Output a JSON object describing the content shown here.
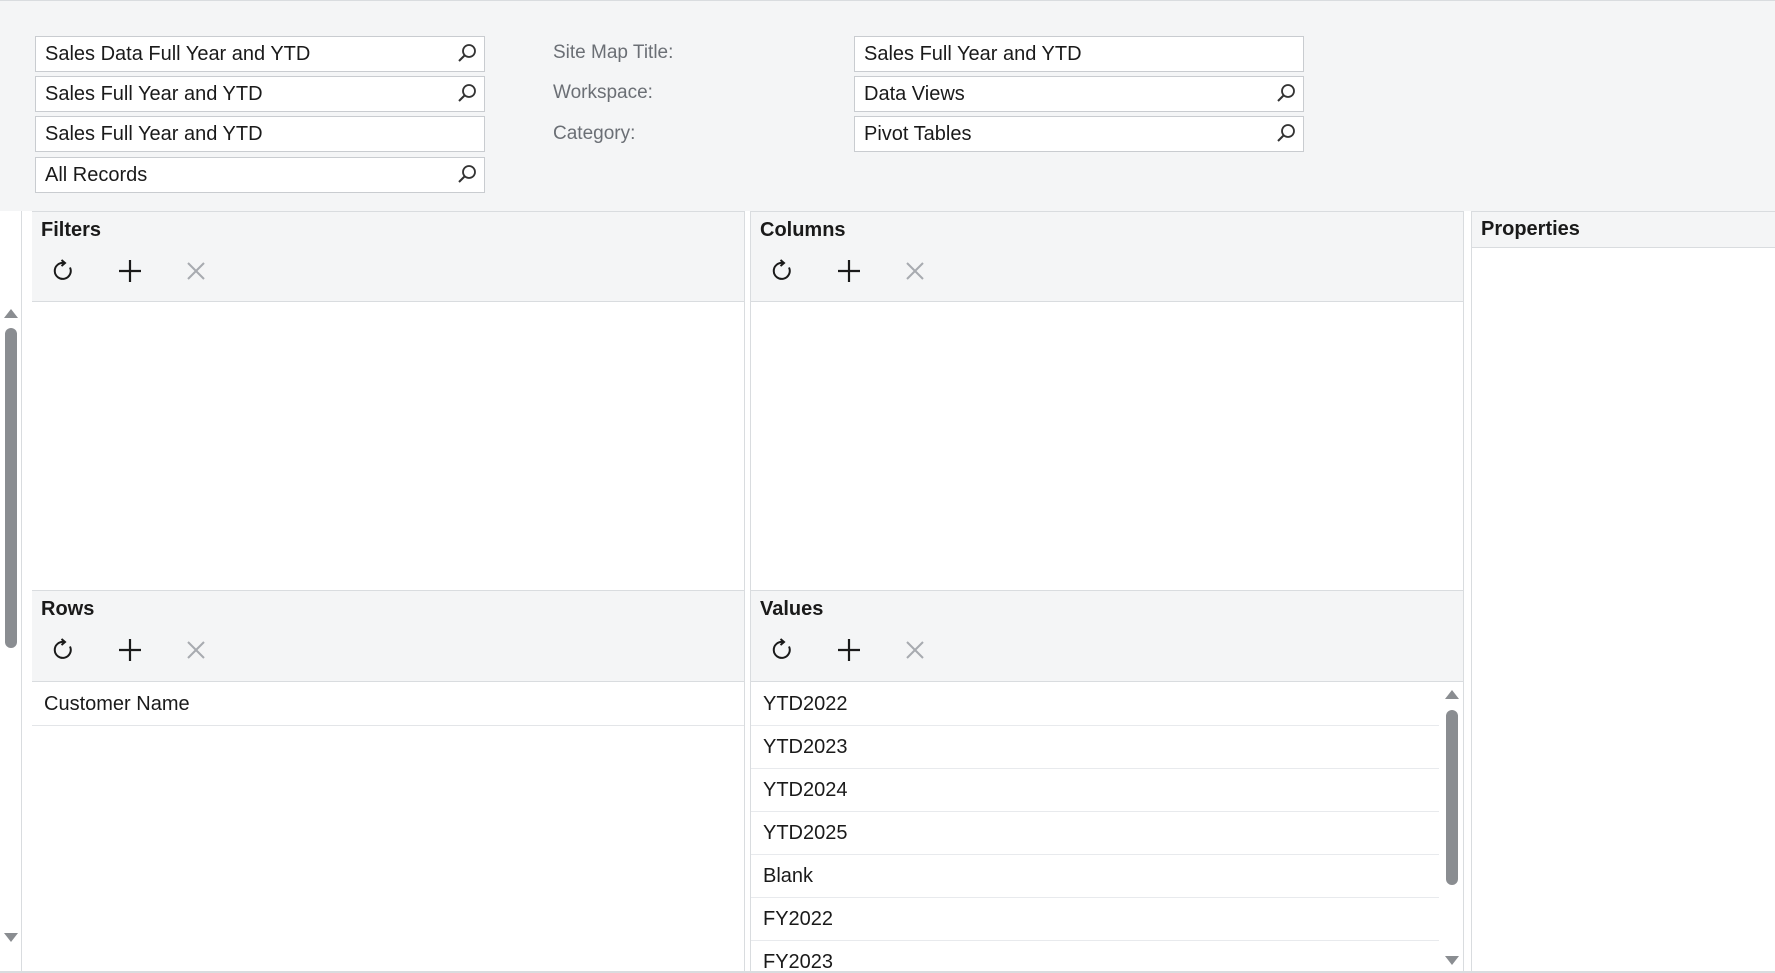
{
  "form": {
    "fields_left": [
      {
        "value": "Sales Data  Full Year and YTD",
        "has_lookup": true
      },
      {
        "value": "Sales Full Year and YTD",
        "has_lookup": true
      },
      {
        "value": "Sales Full Year and YTD",
        "has_lookup": false
      },
      {
        "value": "All Records",
        "has_lookup": true
      }
    ],
    "site_map_title_label": "Site Map Title:",
    "site_map_title_value": "Sales Full Year and YTD",
    "workspace_label": "Workspace:",
    "workspace_value": "Data Views",
    "category_label": "Category:",
    "category_value": "Pivot Tables"
  },
  "panels": {
    "filters": {
      "title": "Filters",
      "items": []
    },
    "columns": {
      "title": "Columns",
      "items": []
    },
    "rows": {
      "title": "Rows",
      "items": [
        "Customer Name"
      ]
    },
    "values": {
      "title": "Values",
      "items": [
        "YTD2022",
        "YTD2023",
        "YTD2024",
        "YTD2025",
        "Blank",
        "FY2022",
        "FY2023"
      ]
    },
    "properties": {
      "title": "Properties"
    }
  },
  "toolbar_icons": [
    "refresh-icon",
    "add-icon",
    "delete-icon"
  ],
  "colors": {
    "header_bg": "#f4f5f6",
    "border": "#d9dcdf",
    "disabled_icon": "#a8abb0"
  }
}
